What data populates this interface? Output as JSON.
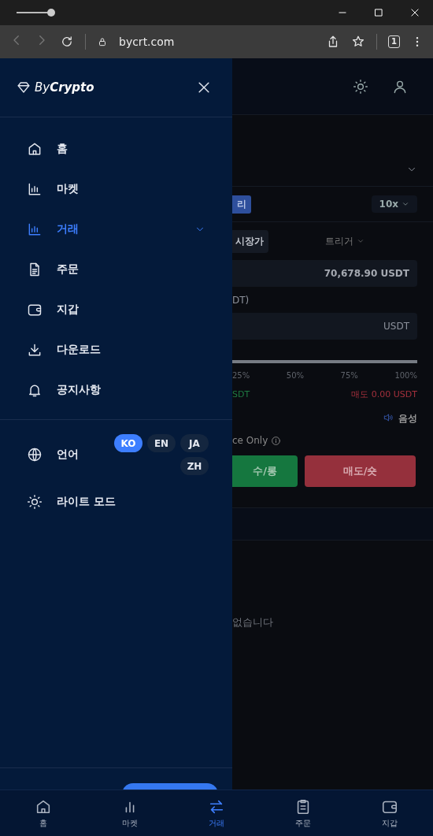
{
  "browser": {
    "url": "bycrt.com",
    "tab_count": "1",
    "zoom": {
      "level": 1
    }
  },
  "drawer": {
    "logo": "By**Crypto**",
    "menu": [
      {
        "label": "홈",
        "selected": false,
        "submenu": false
      },
      {
        "label": "마켓",
        "selected": false,
        "submenu": false
      },
      {
        "label": "거래",
        "selected": true,
        "submenu": true
      },
      {
        "label": "주문",
        "selected": false,
        "submenu": false
      },
      {
        "label": "지갑",
        "selected": false,
        "submenu": false
      },
      {
        "label": "다운로드",
        "selected": false,
        "submenu": false
      },
      {
        "label": "공지사항",
        "selected": false,
        "submenu": false
      }
    ],
    "language": {
      "label": "언어",
      "options": [
        {
          "label": "KO",
          "selected": true
        },
        {
          "label": "EN",
          "selected": false
        },
        {
          "label": "JA",
          "selected": false
        },
        {
          "label": "ZH",
          "selected": false
        }
      ]
    },
    "theme_label": "라이트 모드"
  },
  "trade": {
    "margin_badge": "리",
    "leverage": "10x",
    "order_type": "시장가",
    "trigger": "트리거",
    "price": "70,678.90 USDT",
    "amount_label": "DT)",
    "amount_unit": "USDT",
    "percent_marks": [
      "25%",
      "50%",
      "75%",
      "100%"
    ],
    "buy_max": "SDT",
    "sell_max": "매도 0.00 USDT",
    "sound": "음성",
    "reduce_only": "ce Only",
    "buy_button": "수/롱",
    "sell_button": "매도/숏",
    "empty_message": "없습니다"
  },
  "bottom_nav": [
    {
      "label": "홈",
      "selected": false
    },
    {
      "label": "마켓",
      "selected": false
    },
    {
      "label": "거래",
      "selected": true
    },
    {
      "label": "주문",
      "selected": false
    },
    {
      "label": "지갑",
      "selected": false
    }
  ]
}
